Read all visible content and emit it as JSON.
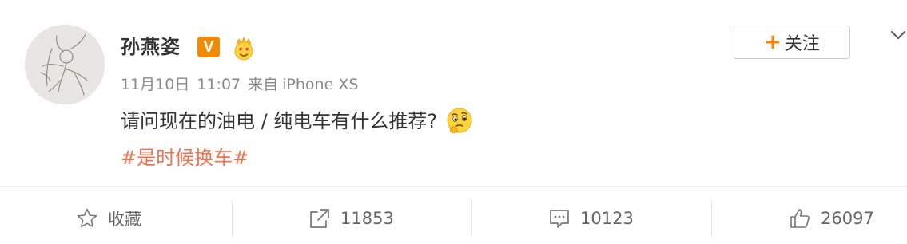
{
  "user": {
    "name": "孙燕姿",
    "verified_badge": "V",
    "verified_color": "#f28a00"
  },
  "follow_button": {
    "plus": "+",
    "label": "关注"
  },
  "post": {
    "date": "11月10日",
    "time": "11:07",
    "source_prefix": "来自",
    "source_device": "iPhone XS",
    "text": "请问现在的油电 / 纯电车有什么推荐?",
    "emoji": "thinking-face-icon",
    "hashtag": "#是时候换车#",
    "hashtag_color": "#eb7350"
  },
  "actions": {
    "favorite": {
      "label": "收藏",
      "icon": "star-icon"
    },
    "repost": {
      "count": "11853",
      "icon": "share-icon"
    },
    "comment": {
      "count": "10123",
      "icon": "comment-icon"
    },
    "like": {
      "count": "26097",
      "icon": "thumbs-up-icon"
    }
  }
}
